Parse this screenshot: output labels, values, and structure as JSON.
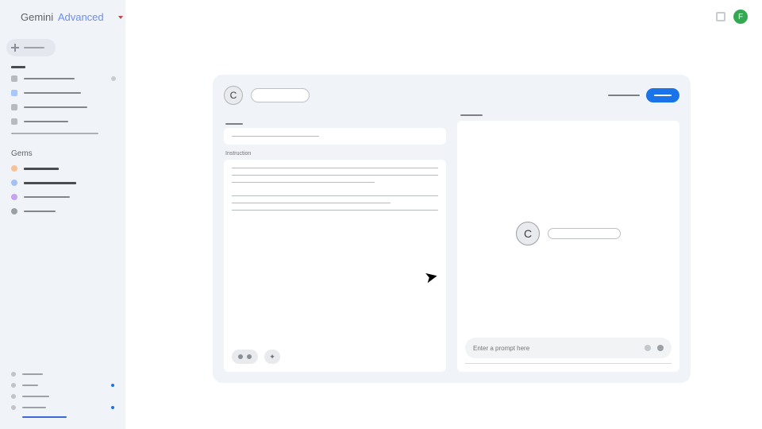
{
  "brand": {
    "name": "Gemini",
    "tier": "Advanced"
  },
  "avatar_letter": "F",
  "sidebar": {
    "recent": [
      {
        "sq_color": "#b7bbc0",
        "len": 64,
        "end_dot": "#c8ccd0"
      },
      {
        "sq_color": "#a8c7fa",
        "len": 72,
        "end_dot": null
      },
      {
        "sq_color": "#b7bbc0",
        "len": 80,
        "end_dot": null
      },
      {
        "sq_color": "#b7bbc0",
        "len": 56,
        "end_dot": null
      }
    ],
    "show_more_len": 110,
    "gems_title": "Gems",
    "gems": [
      {
        "color": "#f6c396",
        "len": 44,
        "thick": true
      },
      {
        "color": "#a3c1f4",
        "len": 66,
        "thick": true
      },
      {
        "color": "#c5a3f4",
        "len": 58,
        "thick": false
      },
      {
        "color": "#9aa0a6",
        "len": 40,
        "thick": false
      }
    ],
    "bottom": [
      {
        "len": 26,
        "ind": false
      },
      {
        "len": 20,
        "ind": true
      },
      {
        "len": 34,
        "ind": false
      },
      {
        "len": 30,
        "ind": true
      }
    ],
    "bottom_link_len": 56
  },
  "gem_editor": {
    "icon_letter": "C",
    "instruction_label": "Instruction",
    "instr_lines": [
      260,
      260,
      180,
      0,
      260,
      200,
      260
    ],
    "prompt_placeholder": "Enter a prompt here",
    "preview_icon_letter": "C"
  }
}
